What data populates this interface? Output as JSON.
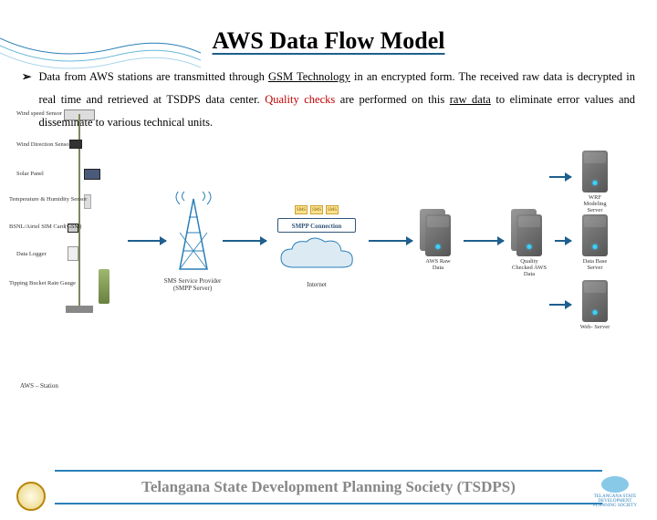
{
  "title": "AWS Data  Flow Model",
  "bullet": {
    "marker": "➢",
    "text_pre": "Data from AWS stations are transmitted through ",
    "gsm": "GSM Technology",
    "text_mid1": " in an encrypted form. The received raw data is decrypted in real time and retrieved at TSDPS data center. ",
    "quality_checks": "Quality checks",
    "text_mid2": " are performed on this ",
    "raw_data": "raw data",
    "text_end": " to eliminate error values and disseminate to various technical units."
  },
  "station": {
    "labels": {
      "wind_speed": "Wind speed Sensor",
      "wind_dir": "Wind Direction Sensor",
      "solar": "Solar Panel",
      "temp": "Temperature & Humidity Sensor",
      "sim": "BSNL/Airtel SIM Card(GSM)",
      "logger": "Data Logger",
      "rain": "Tipping Bucket Rain Gauge"
    },
    "caption": "AWS – Station"
  },
  "tower": {
    "caption": "SMS Service Provider (SMPP Server)"
  },
  "internet": {
    "sms": "SMS",
    "smpp": "SMPP Connection",
    "label": "Internet"
  },
  "servers": {
    "aws_raw": "AWS Raw Data",
    "wrf": "WRF Modeling Server",
    "qc": "Quality Checked AWS Data",
    "db": "Data Base Server",
    "web": "Web- Server"
  },
  "footer": {
    "org": "Telangana State Development Planning Society (TSDPS)",
    "logo_text": "TELANGANA STATE DEVELOPMENT PLANNING SOCIETY"
  }
}
